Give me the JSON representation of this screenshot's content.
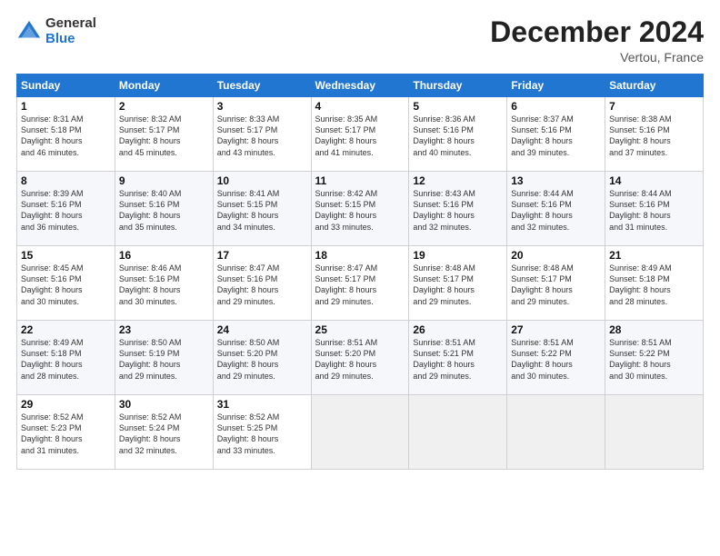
{
  "header": {
    "logo_general": "General",
    "logo_blue": "Blue",
    "month_title": "December 2024",
    "location": "Vertou, France"
  },
  "days_of_week": [
    "Sunday",
    "Monday",
    "Tuesday",
    "Wednesday",
    "Thursday",
    "Friday",
    "Saturday"
  ],
  "weeks": [
    [
      {
        "day": "1",
        "lines": [
          "Sunrise: 8:31 AM",
          "Sunset: 5:18 PM",
          "Daylight: 8 hours",
          "and 46 minutes."
        ]
      },
      {
        "day": "2",
        "lines": [
          "Sunrise: 8:32 AM",
          "Sunset: 5:17 PM",
          "Daylight: 8 hours",
          "and 45 minutes."
        ]
      },
      {
        "day": "3",
        "lines": [
          "Sunrise: 8:33 AM",
          "Sunset: 5:17 PM",
          "Daylight: 8 hours",
          "and 43 minutes."
        ]
      },
      {
        "day": "4",
        "lines": [
          "Sunrise: 8:35 AM",
          "Sunset: 5:17 PM",
          "Daylight: 8 hours",
          "and 41 minutes."
        ]
      },
      {
        "day": "5",
        "lines": [
          "Sunrise: 8:36 AM",
          "Sunset: 5:16 PM",
          "Daylight: 8 hours",
          "and 40 minutes."
        ]
      },
      {
        "day": "6",
        "lines": [
          "Sunrise: 8:37 AM",
          "Sunset: 5:16 PM",
          "Daylight: 8 hours",
          "and 39 minutes."
        ]
      },
      {
        "day": "7",
        "lines": [
          "Sunrise: 8:38 AM",
          "Sunset: 5:16 PM",
          "Daylight: 8 hours",
          "and 37 minutes."
        ]
      }
    ],
    [
      {
        "day": "8",
        "lines": [
          "Sunrise: 8:39 AM",
          "Sunset: 5:16 PM",
          "Daylight: 8 hours",
          "and 36 minutes."
        ]
      },
      {
        "day": "9",
        "lines": [
          "Sunrise: 8:40 AM",
          "Sunset: 5:16 PM",
          "Daylight: 8 hours",
          "and 35 minutes."
        ]
      },
      {
        "day": "10",
        "lines": [
          "Sunrise: 8:41 AM",
          "Sunset: 5:15 PM",
          "Daylight: 8 hours",
          "and 34 minutes."
        ]
      },
      {
        "day": "11",
        "lines": [
          "Sunrise: 8:42 AM",
          "Sunset: 5:15 PM",
          "Daylight: 8 hours",
          "and 33 minutes."
        ]
      },
      {
        "day": "12",
        "lines": [
          "Sunrise: 8:43 AM",
          "Sunset: 5:16 PM",
          "Daylight: 8 hours",
          "and 32 minutes."
        ]
      },
      {
        "day": "13",
        "lines": [
          "Sunrise: 8:44 AM",
          "Sunset: 5:16 PM",
          "Daylight: 8 hours",
          "and 32 minutes."
        ]
      },
      {
        "day": "14",
        "lines": [
          "Sunrise: 8:44 AM",
          "Sunset: 5:16 PM",
          "Daylight: 8 hours",
          "and 31 minutes."
        ]
      }
    ],
    [
      {
        "day": "15",
        "lines": [
          "Sunrise: 8:45 AM",
          "Sunset: 5:16 PM",
          "Daylight: 8 hours",
          "and 30 minutes."
        ]
      },
      {
        "day": "16",
        "lines": [
          "Sunrise: 8:46 AM",
          "Sunset: 5:16 PM",
          "Daylight: 8 hours",
          "and 30 minutes."
        ]
      },
      {
        "day": "17",
        "lines": [
          "Sunrise: 8:47 AM",
          "Sunset: 5:16 PM",
          "Daylight: 8 hours",
          "and 29 minutes."
        ]
      },
      {
        "day": "18",
        "lines": [
          "Sunrise: 8:47 AM",
          "Sunset: 5:17 PM",
          "Daylight: 8 hours",
          "and 29 minutes."
        ]
      },
      {
        "day": "19",
        "lines": [
          "Sunrise: 8:48 AM",
          "Sunset: 5:17 PM",
          "Daylight: 8 hours",
          "and 29 minutes."
        ]
      },
      {
        "day": "20",
        "lines": [
          "Sunrise: 8:48 AM",
          "Sunset: 5:17 PM",
          "Daylight: 8 hours",
          "and 29 minutes."
        ]
      },
      {
        "day": "21",
        "lines": [
          "Sunrise: 8:49 AM",
          "Sunset: 5:18 PM",
          "Daylight: 8 hours",
          "and 28 minutes."
        ]
      }
    ],
    [
      {
        "day": "22",
        "lines": [
          "Sunrise: 8:49 AM",
          "Sunset: 5:18 PM",
          "Daylight: 8 hours",
          "and 28 minutes."
        ]
      },
      {
        "day": "23",
        "lines": [
          "Sunrise: 8:50 AM",
          "Sunset: 5:19 PM",
          "Daylight: 8 hours",
          "and 29 minutes."
        ]
      },
      {
        "day": "24",
        "lines": [
          "Sunrise: 8:50 AM",
          "Sunset: 5:20 PM",
          "Daylight: 8 hours",
          "and 29 minutes."
        ]
      },
      {
        "day": "25",
        "lines": [
          "Sunrise: 8:51 AM",
          "Sunset: 5:20 PM",
          "Daylight: 8 hours",
          "and 29 minutes."
        ]
      },
      {
        "day": "26",
        "lines": [
          "Sunrise: 8:51 AM",
          "Sunset: 5:21 PM",
          "Daylight: 8 hours",
          "and 29 minutes."
        ]
      },
      {
        "day": "27",
        "lines": [
          "Sunrise: 8:51 AM",
          "Sunset: 5:22 PM",
          "Daylight: 8 hours",
          "and 30 minutes."
        ]
      },
      {
        "day": "28",
        "lines": [
          "Sunrise: 8:51 AM",
          "Sunset: 5:22 PM",
          "Daylight: 8 hours",
          "and 30 minutes."
        ]
      }
    ],
    [
      {
        "day": "29",
        "lines": [
          "Sunrise: 8:52 AM",
          "Sunset: 5:23 PM",
          "Daylight: 8 hours",
          "and 31 minutes."
        ]
      },
      {
        "day": "30",
        "lines": [
          "Sunrise: 8:52 AM",
          "Sunset: 5:24 PM",
          "Daylight: 8 hours",
          "and 32 minutes."
        ]
      },
      {
        "day": "31",
        "lines": [
          "Sunrise: 8:52 AM",
          "Sunset: 5:25 PM",
          "Daylight: 8 hours",
          "and 33 minutes."
        ]
      },
      {
        "day": "",
        "lines": []
      },
      {
        "day": "",
        "lines": []
      },
      {
        "day": "",
        "lines": []
      },
      {
        "day": "",
        "lines": []
      }
    ]
  ]
}
